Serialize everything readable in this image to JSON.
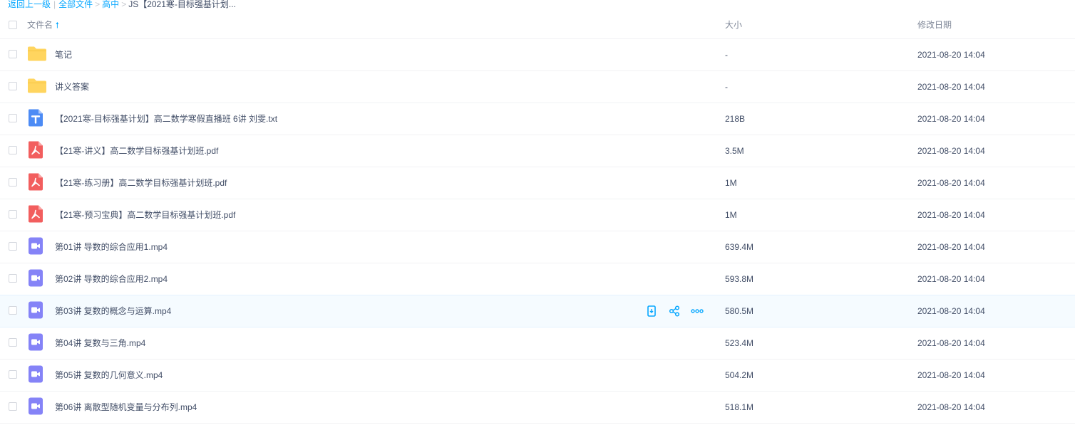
{
  "breadcrumb": {
    "back": "返回上一级",
    "all": "全部文件",
    "level1": "高中",
    "current": "JS【2021寒-目标强基计划..."
  },
  "header": {
    "name": "文件名",
    "size": "大小",
    "date": "修改日期"
  },
  "colors": {
    "accent": "#06a7ff",
    "folder": "#ffd55f",
    "txt": "#4c8bf5",
    "pdf": "#f25e5e",
    "video": "#8583f7"
  },
  "files": [
    {
      "name": "笔记",
      "size": "-",
      "date": "2021-08-20 14:04",
      "type": "folder-icon"
    },
    {
      "name": "讲义答案",
      "size": "-",
      "date": "2021-08-20 14:04",
      "type": "folder-icon"
    },
    {
      "name": "【2021寒-目标强基计划】高二数学寒假直播班 6讲 刘雯.txt",
      "size": "218B",
      "date": "2021-08-20 14:04",
      "type": "txt-file-icon"
    },
    {
      "name": "【21寒-讲义】高二数学目标强基计划班.pdf",
      "size": "3.5M",
      "date": "2021-08-20 14:04",
      "type": "pdf-file-icon"
    },
    {
      "name": "【21寒-练习册】高二数学目标强基计划班.pdf",
      "size": "1M",
      "date": "2021-08-20 14:04",
      "type": "pdf-file-icon"
    },
    {
      "name": "【21寒-预习宝典】高二数学目标强基计划班.pdf",
      "size": "1M",
      "date": "2021-08-20 14:04",
      "type": "pdf-file-icon"
    },
    {
      "name": "第01讲 导数的综合应用1.mp4",
      "size": "639.4M",
      "date": "2021-08-20 14:04",
      "type": "video-file-icon"
    },
    {
      "name": "第02讲 导数的综合应用2.mp4",
      "size": "593.8M",
      "date": "2021-08-20 14:04",
      "type": "video-file-icon"
    },
    {
      "name": "第03讲 复数的概念与运算.mp4",
      "size": "580.5M",
      "date": "2021-08-20 14:04",
      "type": "video-file-icon",
      "hover": true
    },
    {
      "name": "第04讲 复数与三角.mp4",
      "size": "523.4M",
      "date": "2021-08-20 14:04",
      "type": "video-file-icon"
    },
    {
      "name": "第05讲 复数的几何意义.mp4",
      "size": "504.2M",
      "date": "2021-08-20 14:04",
      "type": "video-file-icon"
    },
    {
      "name": "第06讲 离散型随机变量与分布列.mp4",
      "size": "518.1M",
      "date": "2021-08-20 14:04",
      "type": "video-file-icon"
    }
  ],
  "row_actions": [
    "phone-send-icon",
    "share-icon",
    "more-icon"
  ]
}
